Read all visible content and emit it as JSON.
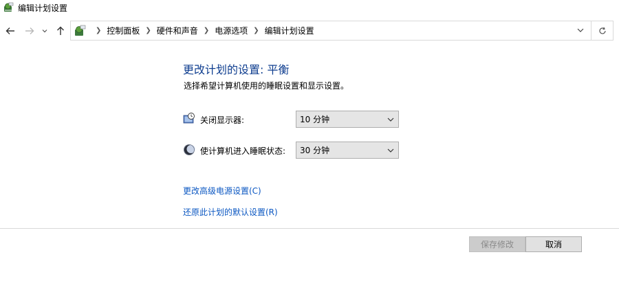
{
  "window": {
    "title": "编辑计划设置"
  },
  "nav": {
    "back_icon": "back-arrow-icon",
    "forward_icon": "forward-arrow-icon",
    "recent_icon": "chevron-down-icon",
    "up_icon": "up-arrow-icon",
    "refresh_icon": "refresh-icon"
  },
  "breadcrumb": {
    "items": [
      "控制面板",
      "硬件和声音",
      "电源选项",
      "编辑计划设置"
    ]
  },
  "main": {
    "heading": "更改计划的设置: 平衡",
    "subheading": "选择希望计算机使用的睡眠设置和显示设置。",
    "settings": [
      {
        "label": "关闭显示器:",
        "value": "10 分钟",
        "icon": "display-clock-icon"
      },
      {
        "label": "使计算机进入睡眠状态:",
        "value": "30 分钟",
        "icon": "sleep-moon-icon"
      }
    ],
    "links": [
      "更改高级电源设置(C)",
      "还原此计划的默认设置(R)"
    ]
  },
  "footer": {
    "save_label": "保存修改",
    "cancel_label": "取消"
  },
  "colors": {
    "heading": "#0e3d8f",
    "link": "#0b57c2",
    "select_bg": "#e5e5e5",
    "button_bg": "#e1e1e1"
  }
}
